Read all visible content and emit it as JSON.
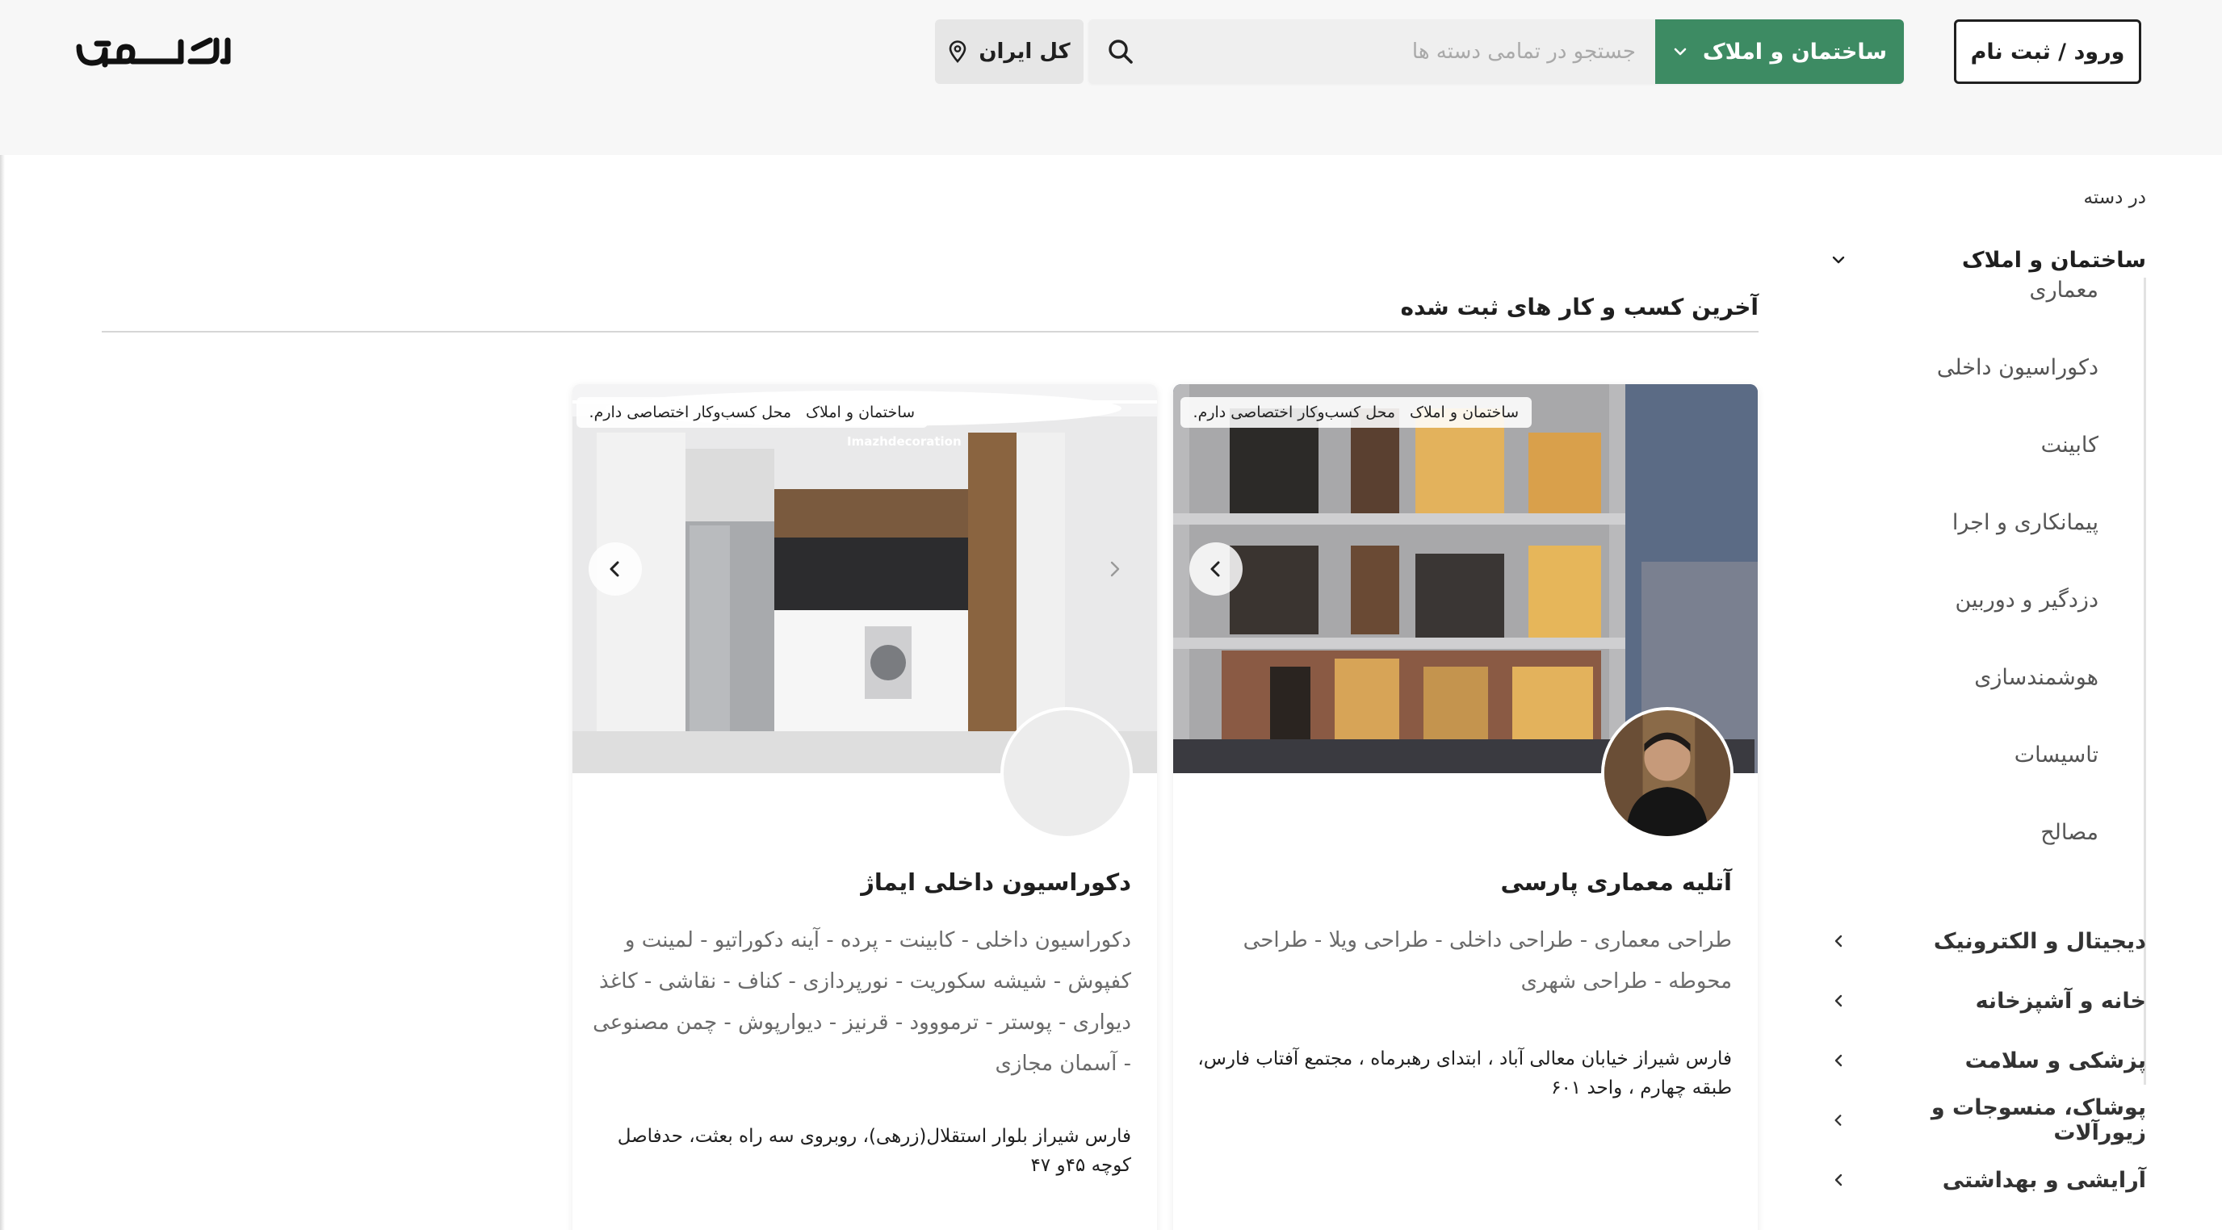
{
  "header": {
    "logo_text": "کارموج",
    "login_label": "ورود / ثبت نام",
    "category_label": "ساختمان و املاک",
    "search_placeholder": "جستجو در تمامی دسته ها",
    "location_label": "کل ایران"
  },
  "sidebar": {
    "heading": "در دسته",
    "active_category": "ساختمان و املاک",
    "sub_items": [
      "معماری",
      "دکوراسیون داخلی",
      "کابینت",
      "پیمانکاری و اجرا",
      "دزدگیر و دوربین",
      "هوشمندسازی",
      "تاسیسات",
      "مصالح"
    ],
    "categories": [
      "دیجیتال و الکترونیک",
      "خانه و آشپزخانه",
      "پزشکی و سلامت",
      "پوشاک، منسوجات و زیورآلات",
      "آرایشی و بهداشتی"
    ]
  },
  "section": {
    "title": "آخرین کسب و کار های ثبت شده"
  },
  "cards": [
    {
      "badge_category": "ساختمان و املاک",
      "badge_note": "محل کسب‌وکار اختصاصی دارم.",
      "title": "آتلیه معماری پارسی",
      "description": "طراحی معماری - طراحی داخلی - طراحی ویلا - طراحی محوطه - طراحی شهری",
      "address": "فارس شیراز خیابان معالی آباد ، ابتدای رهبرماه ، مجتمع آفتاب فارس، طبقه چهارم ، واحد ۶۰۱"
    },
    {
      "badge_category": "ساختمان و املاک",
      "badge_note": "محل کسب‌وکار اختصاصی دارم.",
      "watermark": "Imazhdecoration",
      "title": "دکوراسیون داخلی ایماژ",
      "description": "دکوراسیون داخلی - کابینت - پرده - آینه دکوراتیو - لمینت و کفپوش - شیشه سکوریت - نورپردازی - کناف - نقاشی - کاغذ دیواری - پوستر - ترمووود - قرنیز - دیوارپوش - چمن مصنوعی - آسمان مجازی",
      "address": "فارس شیراز بلوار استقلال(زرهی)، روبروی سه راه بعثت، حدفاصل کوچه ۴۵و ۴۷"
    }
  ],
  "colors": {
    "accent": "#3d8b63",
    "header_bg": "#f7f7f7"
  }
}
